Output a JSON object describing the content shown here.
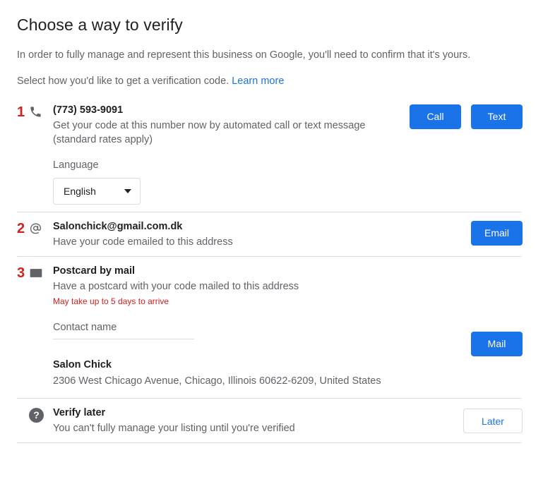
{
  "header": {
    "title": "Choose a way to verify",
    "intro_1": "In order to fully manage and represent this business on Google, you'll need to confirm that it's yours.",
    "intro_2": "Select how you'd like to get a verification code.",
    "learn_more": "Learn more"
  },
  "options": [
    {
      "index": "1",
      "icon": "phone-icon",
      "title": "(773) 593-9091",
      "description": "Get your code at this number now by automated call or text message (standard rates apply)",
      "language_label": "Language",
      "language_value": "English",
      "buttons": [
        {
          "label": "Call",
          "name": "call-button"
        },
        {
          "label": "Text",
          "name": "text-button"
        }
      ]
    },
    {
      "index": "2",
      "icon": "at-sign-icon",
      "title": "Salonchick@gmail.com.dk",
      "description": "Have your code emailed to this address",
      "buttons": [
        {
          "label": "Email",
          "name": "email-button"
        }
      ]
    },
    {
      "index": "3",
      "icon": "envelope-icon",
      "title": "Postcard by mail",
      "description": "Have a postcard with your code mailed to this address",
      "warning": "May take up to 5 days to arrive",
      "contact_placeholder": "Contact name",
      "contact_value": "",
      "address_name": "Salon Chick",
      "address_line": "2306 West Chicago Avenue, Chicago, Illinois 60622-6209, United States",
      "buttons": [
        {
          "label": "Mail",
          "name": "mail-button"
        }
      ]
    }
  ],
  "verify_later": {
    "icon": "help-icon",
    "icon_glyph": "?",
    "title": "Verify later",
    "description": "You can't fully manage your listing until you're verified",
    "button_label": "Later"
  },
  "colors": {
    "accent_blue": "#1a73e8",
    "index_red": "#d32020",
    "text_primary": "#202124",
    "text_secondary": "#5f6368",
    "divider": "#dadce0"
  }
}
